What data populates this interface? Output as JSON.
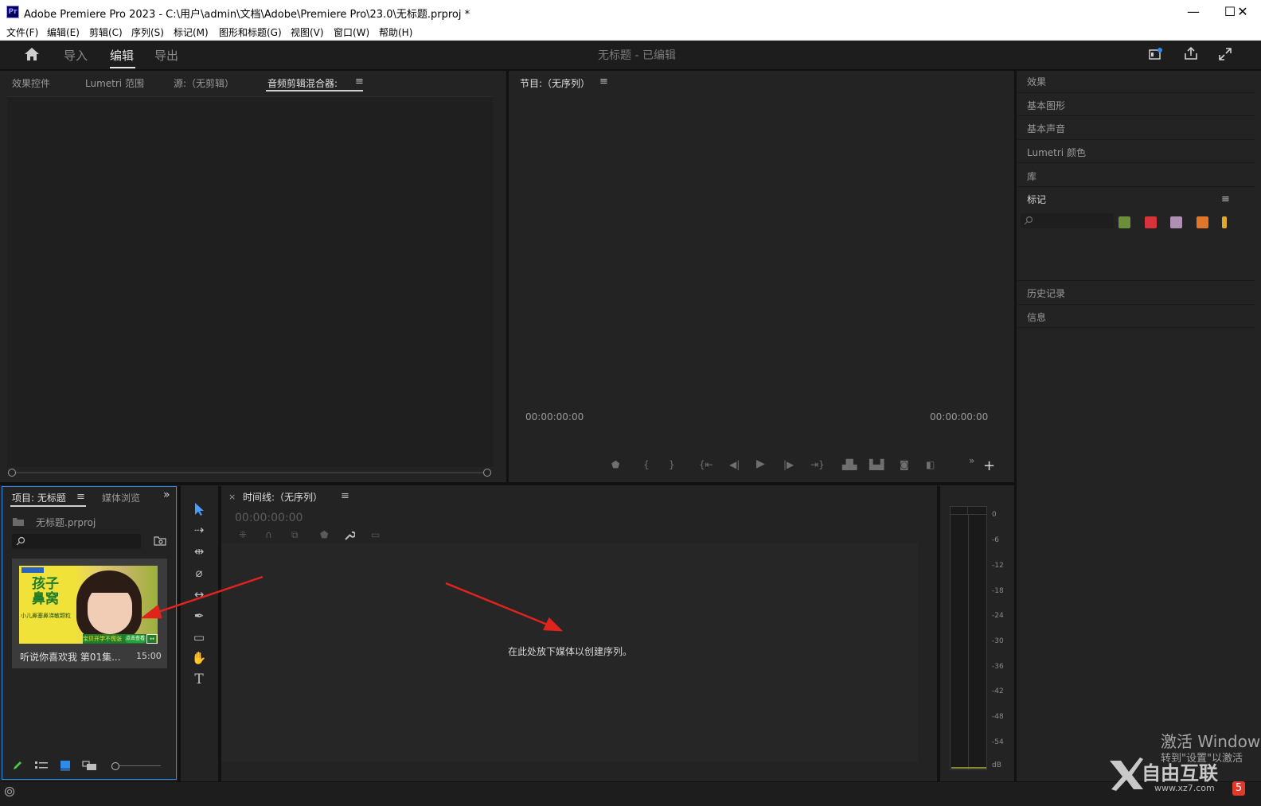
{
  "window": {
    "app_icon": "Pr",
    "title": "Adobe Premiere Pro 2023 - C:\\用户\\admin\\文档\\Adobe\\Premiere Pro\\23.0\\无标题.prproj *",
    "minimize": "—",
    "maximize": "☐",
    "close": "✕"
  },
  "menu": {
    "file": "文件(F)",
    "edit": "编辑(E)",
    "clip": "剪辑(C)",
    "sequence": "序列(S)",
    "markers": "标记(M)",
    "graphics": "图形和标题(G)",
    "view": "视图(V)",
    "window": "窗口(W)",
    "help": "帮助(H)"
  },
  "header": {
    "home_icon": "home-icon",
    "tab_import": "导入",
    "tab_edit": "编辑",
    "tab_export": "导出",
    "project_status": "无标题 - 已编辑"
  },
  "source_panel": {
    "tab_effect_controls": "效果控件",
    "tab_lumetri_scopes": "Lumetri 范围",
    "tab_source": "源:（无剪辑）",
    "tab_audio_mixer": "音频剪辑混合器:",
    "menu": "≡"
  },
  "program_panel": {
    "title": "节目:（无序列）",
    "menu": "≡",
    "timecode_left": "00:00:00:00",
    "timecode_right": "00:00:00:00",
    "add": "+",
    "more": "»"
  },
  "right_panels": {
    "effects": "效果",
    "essential_graphics": "基本图形",
    "essential_sound": "基本声音",
    "lumetri_color": "Lumetri 颜色",
    "libraries": "库",
    "markers": "标记",
    "markers_menu": "≡",
    "history": "历史记录",
    "info": "信息",
    "marker_colors": [
      "#6b8e3a",
      "#d8333a",
      "#b08fb5",
      "#e0762a",
      "#e0a92a"
    ]
  },
  "project_panel": {
    "tab_project": "项目: 无标题",
    "tab_menu": "≡",
    "tab_media_browser": "媒体浏览",
    "overflow": "»",
    "file_name": "无标题.prproj",
    "clip": {
      "name": "听说你喜欢我 第01集...",
      "duration": "15:00",
      "thumb_text_main": "孩子\n鼻窝",
      "thumb_text_sub": "小儿鼻塞鼻涕敏颗粒",
      "thumb_banner": "宝贝开学不慌张",
      "thumb_btn": "点击查看"
    }
  },
  "timeline_panel": {
    "close": "×",
    "title": "时间线:（无序列）",
    "menu": "≡",
    "timecode": "00:00:00:00",
    "drop_hint": "在此处放下媒体以创建序列。"
  },
  "audio_meter": {
    "labels": [
      "0",
      "-6",
      "-12",
      "-18",
      "-24",
      "-30",
      "-36",
      "-42",
      "-48",
      "-54",
      "dB"
    ]
  },
  "watermark": {
    "activate_line1": "激活 Window",
    "activate_line2": "转到\"设置\"以激活",
    "site_logo": "自由互联",
    "site_url": "www.xz7.com"
  }
}
